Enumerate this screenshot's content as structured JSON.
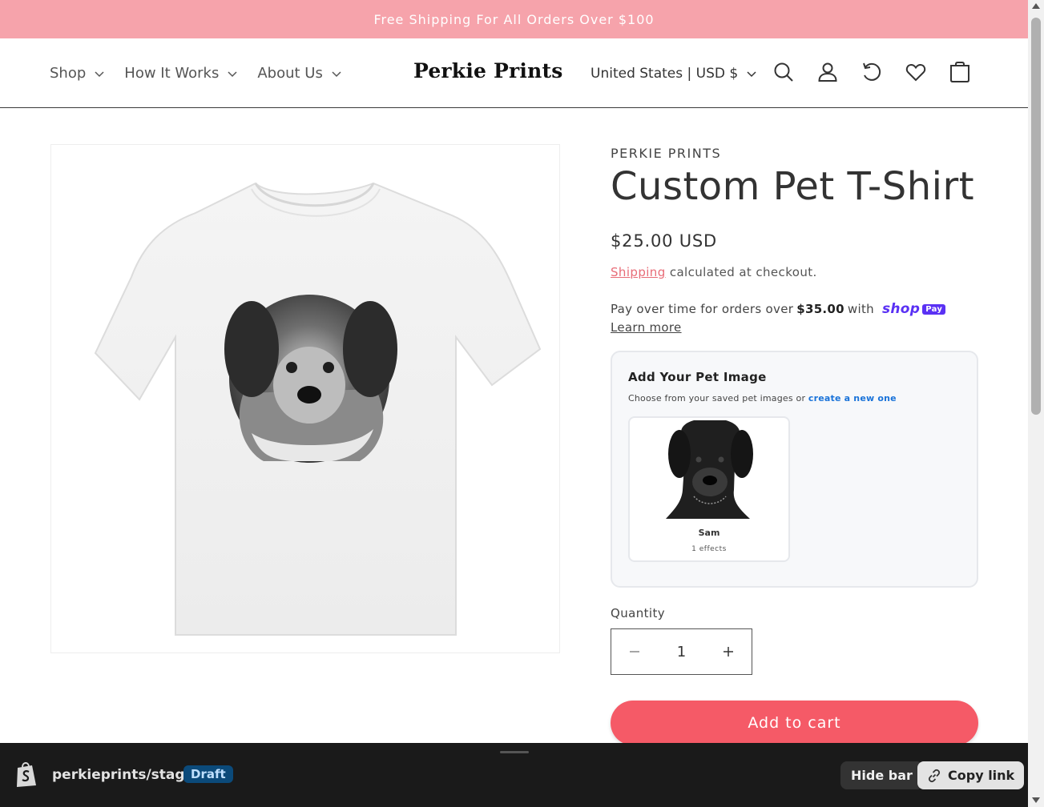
{
  "announcement": "Free Shipping For All Orders Over $100",
  "nav": {
    "items": [
      {
        "label": "Shop"
      },
      {
        "label": "How It Works"
      },
      {
        "label": "About Us"
      }
    ]
  },
  "logo": "Perkie Prints",
  "locale": "United States | USD $",
  "header_icons": [
    "search-icon",
    "account-icon",
    "history-icon",
    "heart-icon",
    "cart-icon"
  ],
  "product": {
    "vendor": "PERKIE PRINTS",
    "title": "Custom Pet T-Shirt",
    "price": "$25.00 USD",
    "shipping_link": "Shipping",
    "shipping_text": "calculated at checkout.",
    "pay_over_time": "Pay over time for orders over",
    "pay_threshold": "$35.00",
    "pay_with": "with",
    "shop_pay_word": "shop",
    "shop_pay_badge": "Pay",
    "learn_more": "Learn more"
  },
  "pet_picker": {
    "heading": "Add Your Pet Image",
    "subtext": "Choose from your saved pet images or",
    "create_link": "create a new one",
    "pets": [
      {
        "name": "Sam",
        "effects": "1 effects"
      }
    ]
  },
  "quantity": {
    "label": "Quantity",
    "value": "1",
    "minus": "−",
    "plus": "+"
  },
  "add_to_cart": "Add to cart",
  "preview_bar": {
    "store": "perkieprints/staging",
    "badge": "Draft",
    "hide_label": "Hide bar",
    "copy_label": "Copy link"
  },
  "colors": {
    "announcement_bg": "#f6a3ab",
    "accent": "#f55a67",
    "shop_pay": "#5a31f4",
    "link_blue": "#1a73d9"
  }
}
